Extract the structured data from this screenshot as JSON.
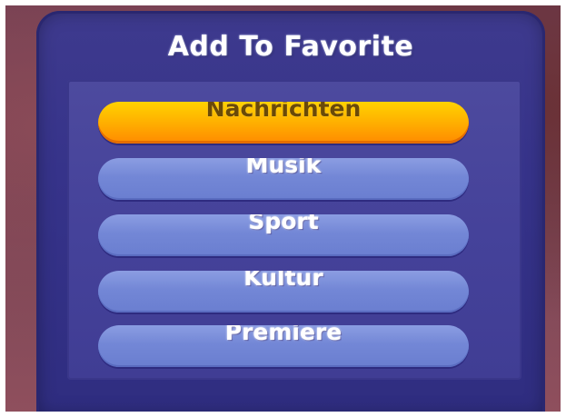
{
  "dialog": {
    "title": "Add To Favorite",
    "items": [
      {
        "label": "Nachrichten",
        "selected": true
      },
      {
        "label": "Musik",
        "selected": false
      },
      {
        "label": "Sport",
        "selected": false
      },
      {
        "label": "Kultur",
        "selected": false
      },
      {
        "label": "Premiere",
        "selected": false
      }
    ]
  },
  "colors": {
    "dialog_background": "#36338a",
    "item_normal": "#7387d6",
    "item_selected": "#ffb300"
  }
}
